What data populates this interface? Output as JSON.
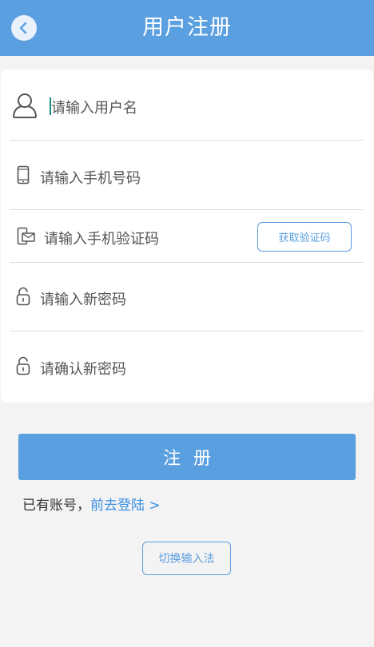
{
  "header": {
    "title": "用户注册",
    "back_icon": "chevron-left-icon"
  },
  "form": {
    "username_placeholder": "请输入用户名",
    "username_icon": "user-icon",
    "phone_placeholder": "请输入手机号码",
    "phone_icon": "phone-icon",
    "code_placeholder": "请输入手机验证码",
    "code_icon": "sms-code-icon",
    "get_code_label": "获取验证码",
    "password_placeholder": "请输入新密码",
    "password_icon": "lock-icon",
    "confirm_placeholder": "请确认新密码",
    "confirm_icon": "lock-icon"
  },
  "submit_label": "注册",
  "login_prompt": {
    "text": "已有账号，",
    "link": "前去登陆 >"
  },
  "ime_switch_label": "切换输入法",
  "colors": {
    "primary": "#5a9fe0",
    "link": "#3a8ee3",
    "background": "#f3f3f3"
  }
}
